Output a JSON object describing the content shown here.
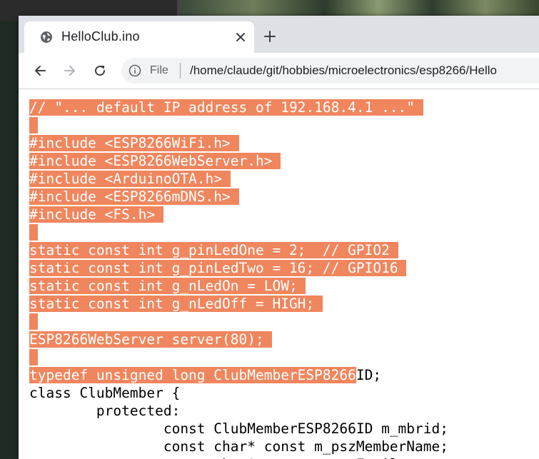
{
  "browser": {
    "tab_title": "HelloClub.ino",
    "scheme_label": "File",
    "url": "/home/claude/git/hobbies/microelectronics/esp8266/Hello"
  },
  "colors": {
    "selection": "#f0865e",
    "tabstrip": "#dee1e6"
  },
  "icons": {
    "tab": "globe-icon",
    "close": "close-icon",
    "newtab": "plus-icon",
    "back": "back-arrow-icon",
    "forward": "forward-arrow-icon",
    "reload": "reload-icon",
    "info": "info-icon"
  },
  "code_lines": [
    {
      "sel": "// \"... default IP address of 192.168.4.1 ...\" ",
      "rest": ""
    },
    {
      "sel": " ",
      "rest": ""
    },
    {
      "sel": "#include <ESP8266WiFi.h> ",
      "rest": ""
    },
    {
      "sel": "#include <ESP8266WebServer.h> ",
      "rest": ""
    },
    {
      "sel": "#include <ArduinoOTA.h> ",
      "rest": ""
    },
    {
      "sel": "#include <ESP8266mDNS.h> ",
      "rest": ""
    },
    {
      "sel": "#include <FS.h> ",
      "rest": ""
    },
    {
      "sel": " ",
      "rest": ""
    },
    {
      "sel": "static const int g_pinLedOne = 2;  // GPIO2 ",
      "rest": ""
    },
    {
      "sel": "static const int g_pinLedTwo = 16; // GPIO16 ",
      "rest": ""
    },
    {
      "sel": "static const int g_nLedOn = LOW; ",
      "rest": ""
    },
    {
      "sel": "static const int g_nLedOff = HIGH; ",
      "rest": ""
    },
    {
      "sel": " ",
      "rest": ""
    },
    {
      "sel": "ESP8266WebServer server(80); ",
      "rest": ""
    },
    {
      "sel": " ",
      "rest": ""
    },
    {
      "sel": "typedef unsigned long ClubMemberESP8266",
      "rest": "ID;"
    },
    {
      "sel": "",
      "rest": "class ClubMember {"
    },
    {
      "sel": "",
      "rest": "        protected:"
    },
    {
      "sel": "",
      "rest": "                const ClubMemberESP8266ID m_mbrid;"
    },
    {
      "sel": "",
      "rest": "                const char* const m_pszMemberName;"
    },
    {
      "sel": "",
      "rest": "                const char* const m_pszEmail;"
    }
  ]
}
